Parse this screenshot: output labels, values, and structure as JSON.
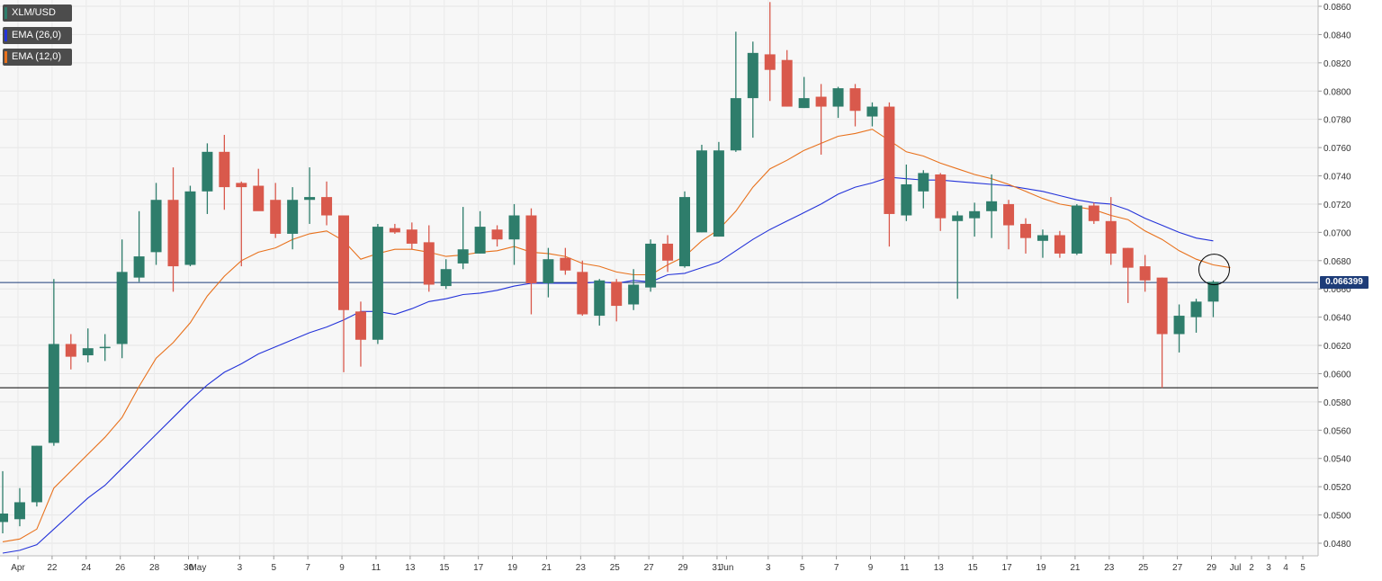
{
  "chart_data": {
    "type": "candlestick",
    "symbol": "XLM/USD",
    "indicators": [
      {
        "name": "EMA (26,0)",
        "color": "#2433d9"
      },
      {
        "name": "EMA (12,0)",
        "color": "#e8711c"
      }
    ],
    "colors": {
      "up": "#2e7d6b",
      "down": "#d9594c",
      "background": "#f7f7f7"
    },
    "last_price_label": "0.066399",
    "last_price": 0.06645,
    "support_level": 0.059,
    "ylim": [
      0.047,
      0.0862
    ],
    "y_ticks": [
      "0.0480",
      "0.0500",
      "0.0520",
      "0.0540",
      "0.0560",
      "0.0580",
      "0.0600",
      "0.0620",
      "0.0640",
      "0.0660",
      "0.0680",
      "0.0700",
      "0.0720",
      "0.0740",
      "0.0760",
      "0.0780",
      "0.0800",
      "0.0820",
      "0.0840",
      "0.0860"
    ],
    "x_tick_labels": [
      "Apr",
      "22",
      "24",
      "26",
      "28",
      "30",
      "May",
      "3",
      "5",
      "7",
      "9",
      "11",
      "13",
      "15",
      "17",
      "19",
      "21",
      "23",
      "25",
      "27",
      "29",
      "31",
      "Jun",
      "3",
      "5",
      "7",
      "9",
      "11",
      "13",
      "15",
      "17",
      "19",
      "21",
      "23",
      "25",
      "27",
      "29",
      "Jul",
      "2",
      "3",
      "4",
      "5"
    ],
    "candles": [
      {
        "date": "Apr 20",
        "open": 0.0495,
        "high": 0.0531,
        "low": 0.0487,
        "close": 0.0501
      },
      {
        "date": "Apr 21",
        "open": 0.0497,
        "high": 0.0519,
        "low": 0.0492,
        "close": 0.0509
      },
      {
        "date": "Apr 22",
        "open": 0.0509,
        "high": 0.0549,
        "low": 0.0506,
        "close": 0.0549
      },
      {
        "date": "Apr 23",
        "open": 0.0551,
        "high": 0.0667,
        "low": 0.0549,
        "close": 0.0621
      },
      {
        "date": "Apr 24",
        "open": 0.0621,
        "high": 0.0628,
        "low": 0.0603,
        "close": 0.0612
      },
      {
        "date": "Apr 25",
        "open": 0.0613,
        "high": 0.0632,
        "low": 0.0608,
        "close": 0.0618
      },
      {
        "date": "Apr 26",
        "open": 0.0619,
        "high": 0.0628,
        "low": 0.0609,
        "close": 0.0619
      },
      {
        "date": "Apr 27",
        "open": 0.0621,
        "high": 0.0695,
        "low": 0.0611,
        "close": 0.0672
      },
      {
        "date": "Apr 28",
        "open": 0.0668,
        "high": 0.0715,
        "low": 0.0665,
        "close": 0.0683
      },
      {
        "date": "Apr 29",
        "open": 0.0686,
        "high": 0.0735,
        "low": 0.0677,
        "close": 0.0723
      },
      {
        "date": "Apr 30",
        "open": 0.0723,
        "high": 0.0746,
        "low": 0.0658,
        "close": 0.0676
      },
      {
        "date": "May 1",
        "open": 0.0677,
        "high": 0.0733,
        "low": 0.0676,
        "close": 0.0729
      },
      {
        "date": "May 2",
        "open": 0.0729,
        "high": 0.0763,
        "low": 0.0713,
        "close": 0.0757
      },
      {
        "date": "May 3",
        "open": 0.0757,
        "high": 0.0769,
        "low": 0.0716,
        "close": 0.0732
      },
      {
        "date": "May 4",
        "open": 0.0735,
        "high": 0.0736,
        "low": 0.0676,
        "close": 0.0732
      },
      {
        "date": "May 5",
        "open": 0.0733,
        "high": 0.0745,
        "low": 0.0717,
        "close": 0.0715
      },
      {
        "date": "May 6",
        "open": 0.0723,
        "high": 0.0735,
        "low": 0.0696,
        "close": 0.0699
      },
      {
        "date": "May 7",
        "open": 0.0699,
        "high": 0.0732,
        "low": 0.0688,
        "close": 0.0723
      },
      {
        "date": "May 8",
        "open": 0.0723,
        "high": 0.0746,
        "low": 0.0706,
        "close": 0.0725
      },
      {
        "date": "May 9",
        "open": 0.0725,
        "high": 0.0736,
        "low": 0.0705,
        "close": 0.0712
      },
      {
        "date": "May 10",
        "open": 0.0712,
        "high": 0.0712,
        "low": 0.0601,
        "close": 0.0645
      },
      {
        "date": "May 11",
        "open": 0.0644,
        "high": 0.0651,
        "low": 0.0605,
        "close": 0.0624
      },
      {
        "date": "May 12",
        "open": 0.0624,
        "high": 0.0706,
        "low": 0.0621,
        "close": 0.0704
      },
      {
        "date": "May 13",
        "open": 0.0703,
        "high": 0.0706,
        "low": 0.0699,
        "close": 0.07
      },
      {
        "date": "May 14",
        "open": 0.0702,
        "high": 0.0707,
        "low": 0.0688,
        "close": 0.0692
      },
      {
        "date": "May 15",
        "open": 0.0693,
        "high": 0.0705,
        "low": 0.0658,
        "close": 0.0663
      },
      {
        "date": "May 16",
        "open": 0.0662,
        "high": 0.0681,
        "low": 0.066,
        "close": 0.0674
      },
      {
        "date": "May 17",
        "open": 0.0678,
        "high": 0.0718,
        "low": 0.0674,
        "close": 0.0688
      },
      {
        "date": "May 18",
        "open": 0.0685,
        "high": 0.0715,
        "low": 0.0685,
        "close": 0.0704
      },
      {
        "date": "May 19",
        "open": 0.0702,
        "high": 0.0705,
        "low": 0.069,
        "close": 0.0695
      },
      {
        "date": "May 20",
        "open": 0.0695,
        "high": 0.072,
        "low": 0.0677,
        "close": 0.0712
      },
      {
        "date": "May 21",
        "open": 0.0712,
        "high": 0.0717,
        "low": 0.0642,
        "close": 0.0664
      },
      {
        "date": "May 22",
        "open": 0.0664,
        "high": 0.0689,
        "low": 0.0654,
        "close": 0.0681
      },
      {
        "date": "May 23",
        "open": 0.0682,
        "high": 0.0689,
        "low": 0.067,
        "close": 0.0673
      },
      {
        "date": "May 24",
        "open": 0.0672,
        "high": 0.068,
        "low": 0.0641,
        "close": 0.0642
      },
      {
        "date": "May 25",
        "open": 0.0641,
        "high": 0.0667,
        "low": 0.0634,
        "close": 0.0666
      },
      {
        "date": "May 26",
        "open": 0.0665,
        "high": 0.0667,
        "low": 0.0637,
        "close": 0.0648
      },
      {
        "date": "May 27",
        "open": 0.0649,
        "high": 0.0674,
        "low": 0.0645,
        "close": 0.0663
      },
      {
        "date": "May 28",
        "open": 0.0661,
        "high": 0.0695,
        "low": 0.0658,
        "close": 0.0692
      },
      {
        "date": "May 29",
        "open": 0.0692,
        "high": 0.0698,
        "low": 0.0672,
        "close": 0.068
      },
      {
        "date": "May 30",
        "open": 0.0676,
        "high": 0.0729,
        "low": 0.0675,
        "close": 0.0725
      },
      {
        "date": "May 31",
        "open": 0.07,
        "high": 0.0762,
        "low": 0.07,
        "close": 0.0758
      },
      {
        "date": "Jun 1",
        "open": 0.0697,
        "high": 0.0764,
        "low": 0.0697,
        "close": 0.0758
      },
      {
        "date": "Jun 2",
        "open": 0.0758,
        "high": 0.0842,
        "low": 0.0757,
        "close": 0.0795
      },
      {
        "date": "Jun 3",
        "open": 0.0795,
        "high": 0.0835,
        "low": 0.0767,
        "close": 0.0827
      },
      {
        "date": "Jun 4",
        "open": 0.0826,
        "high": 0.0863,
        "low": 0.0793,
        "close": 0.0815
      },
      {
        "date": "Jun 5",
        "open": 0.0822,
        "high": 0.0829,
        "low": 0.0789,
        "close": 0.0789
      },
      {
        "date": "Jun 6",
        "open": 0.0788,
        "high": 0.081,
        "low": 0.0788,
        "close": 0.0795
      },
      {
        "date": "Jun 7",
        "open": 0.0796,
        "high": 0.0805,
        "low": 0.0755,
        "close": 0.0789
      },
      {
        "date": "Jun 8",
        "open": 0.0789,
        "high": 0.0803,
        "low": 0.0781,
        "close": 0.0802
      },
      {
        "date": "Jun 9",
        "open": 0.0802,
        "high": 0.0805,
        "low": 0.0775,
        "close": 0.0786
      },
      {
        "date": "Jun 10",
        "open": 0.0782,
        "high": 0.0792,
        "low": 0.0775,
        "close": 0.0789
      },
      {
        "date": "Jun 11",
        "open": 0.0789,
        "high": 0.0792,
        "low": 0.069,
        "close": 0.0713
      },
      {
        "date": "Jun 12",
        "open": 0.0712,
        "high": 0.0748,
        "low": 0.0708,
        "close": 0.0734
      },
      {
        "date": "Jun 13",
        "open": 0.0729,
        "high": 0.0744,
        "low": 0.0717,
        "close": 0.0742
      },
      {
        "date": "Jun 14",
        "open": 0.0741,
        "high": 0.0742,
        "low": 0.0701,
        "close": 0.071
      },
      {
        "date": "Jun 15",
        "open": 0.0708,
        "high": 0.0715,
        "low": 0.0653,
        "close": 0.0712
      },
      {
        "date": "Jun 16",
        "open": 0.071,
        "high": 0.0721,
        "low": 0.0697,
        "close": 0.0715
      },
      {
        "date": "Jun 17",
        "open": 0.0715,
        "high": 0.0741,
        "low": 0.0696,
        "close": 0.0722
      },
      {
        "date": "Jun 18",
        "open": 0.072,
        "high": 0.0723,
        "low": 0.0688,
        "close": 0.0705
      },
      {
        "date": "Jun 19",
        "open": 0.0706,
        "high": 0.071,
        "low": 0.0685,
        "close": 0.0696
      },
      {
        "date": "Jun 20",
        "open": 0.0694,
        "high": 0.0702,
        "low": 0.0682,
        "close": 0.0698
      },
      {
        "date": "Jun 21",
        "open": 0.0698,
        "high": 0.0701,
        "low": 0.0682,
        "close": 0.0685
      },
      {
        "date": "Jun 22",
        "open": 0.0685,
        "high": 0.072,
        "low": 0.0684,
        "close": 0.0719
      },
      {
        "date": "Jun 23",
        "open": 0.0719,
        "high": 0.0721,
        "low": 0.0706,
        "close": 0.0708
      },
      {
        "date": "Jun 24",
        "open": 0.0708,
        "high": 0.0725,
        "low": 0.0677,
        "close": 0.0685
      },
      {
        "date": "Jun 25",
        "open": 0.0689,
        "high": 0.0689,
        "low": 0.065,
        "close": 0.0675
      },
      {
        "date": "Jun 26",
        "open": 0.0676,
        "high": 0.0684,
        "low": 0.0658,
        "close": 0.0666
      },
      {
        "date": "Jun 27",
        "open": 0.0668,
        "high": 0.0668,
        "low": 0.059,
        "close": 0.0628
      },
      {
        "date": "Jun 28",
        "open": 0.0628,
        "high": 0.0649,
        "low": 0.0615,
        "close": 0.0641
      },
      {
        "date": "Jun 29",
        "open": 0.064,
        "high": 0.0653,
        "low": 0.0629,
        "close": 0.0651
      },
      {
        "date": "Jun 30",
        "open": 0.0651,
        "high": 0.0666,
        "low": 0.064,
        "close": 0.0665
      }
    ],
    "ema26": [
      0.0473,
      0.0475,
      0.0479,
      0.049,
      0.0501,
      0.0512,
      0.0521,
      0.0533,
      0.0545,
      0.0557,
      0.0569,
      0.0581,
      0.0592,
      0.0601,
      0.0607,
      0.0614,
      0.0619,
      0.0624,
      0.0629,
      0.0633,
      0.0638,
      0.0644,
      0.0644,
      0.0642,
      0.0646,
      0.0651,
      0.0653,
      0.0656,
      0.0657,
      0.0659,
      0.0662,
      0.0664,
      0.0664,
      0.0664,
      0.0664,
      0.0665,
      0.0664,
      0.0666,
      0.0665,
      0.067,
      0.0671,
      0.0675,
      0.0679,
      0.0687,
      0.0695,
      0.0702,
      0.0708,
      0.0714,
      0.072,
      0.0727,
      0.0732,
      0.0735,
      0.0739,
      0.0738,
      0.0737,
      0.0737,
      0.0736,
      0.0735,
      0.0734,
      0.0733,
      0.0731,
      0.0729,
      0.0726,
      0.0723,
      0.0721,
      0.072,
      0.0716,
      0.071,
      0.0705,
      0.07,
      0.0696,
      0.0694
    ],
    "ema12": [
      0.0481,
      0.0483,
      0.049,
      0.0519,
      0.0531,
      0.0543,
      0.0555,
      0.0569,
      0.0591,
      0.0611,
      0.0622,
      0.0636,
      0.0655,
      0.0669,
      0.068,
      0.0686,
      0.0689,
      0.0695,
      0.0699,
      0.0701,
      0.0694,
      0.0681,
      0.0685,
      0.0688,
      0.0688,
      0.0686,
      0.0683,
      0.0684,
      0.0686,
      0.0687,
      0.069,
      0.0686,
      0.0685,
      0.0683,
      0.0678,
      0.0676,
      0.0672,
      0.067,
      0.067,
      0.0677,
      0.0683,
      0.0694,
      0.0702,
      0.0715,
      0.0732,
      0.0745,
      0.0751,
      0.0758,
      0.0763,
      0.0768,
      0.077,
      0.0773,
      0.0765,
      0.0757,
      0.0754,
      0.0749,
      0.0745,
      0.0741,
      0.0738,
      0.0734,
      0.0729,
      0.0724,
      0.072,
      0.0718,
      0.0716,
      0.0712,
      0.0709,
      0.0701,
      0.0695,
      0.0687,
      0.0681,
      0.0677,
      0.0675
    ]
  }
}
